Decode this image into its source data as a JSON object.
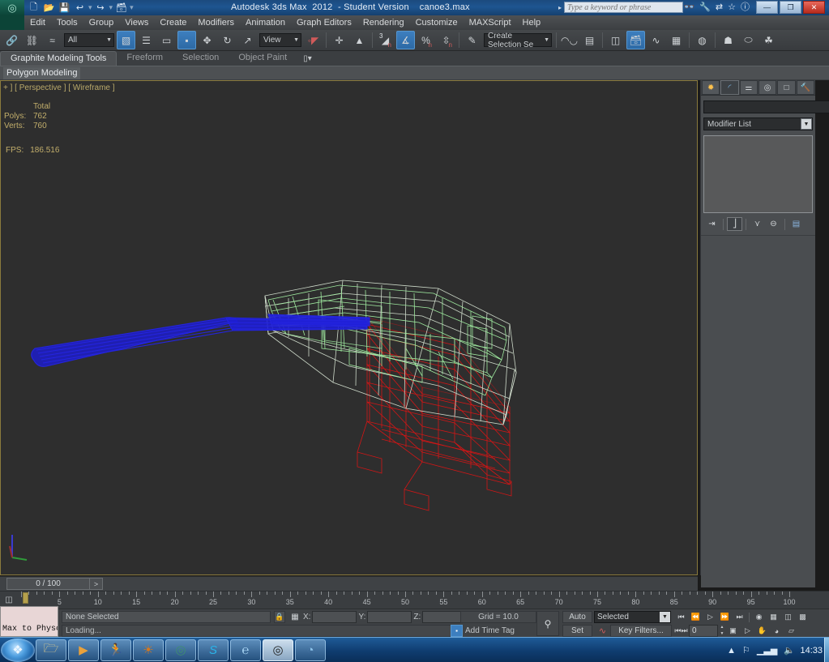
{
  "titlebar": {
    "title": "Autodesk 3ds Max  2012  - Student Version    canoe3.max",
    "search_placeholder": "Type a keyword or phrase",
    "help_icons": [
      "binoculars-icon",
      "wrench-icon",
      "exchange-icon",
      "star-icon",
      "help-icon"
    ],
    "window_buttons": {
      "minimize": "—",
      "maximize": "❐",
      "close": "✕"
    },
    "quick_access": [
      "new-file-icon",
      "open-file-icon",
      "save-file-icon",
      "undo-icon",
      "redo-icon",
      "project-folder-icon",
      "customize-qat-icon"
    ]
  },
  "menubar": {
    "items": [
      {
        "label": "Edit"
      },
      {
        "label": "Tools"
      },
      {
        "label": "Group"
      },
      {
        "label": "Views"
      },
      {
        "label": "Create"
      },
      {
        "label": "Modifiers"
      },
      {
        "label": "Animation"
      },
      {
        "label": "Graph Editors"
      },
      {
        "label": "Rendering"
      },
      {
        "label": "Customize"
      },
      {
        "label": "MAXScript"
      },
      {
        "label": "Help"
      }
    ]
  },
  "main_toolbar": {
    "selection_filter": "All",
    "reference_coord_system": "View",
    "named_selection_set": "Create Selection Se",
    "buttons": [
      {
        "name": "select-and-link-icon",
        "glyph": "🔗"
      },
      {
        "name": "unlink-selection-icon",
        "glyph": "⛓"
      },
      {
        "name": "bind-to-space-warp-icon",
        "glyph": "≈"
      },
      {
        "name": "select-object-icon",
        "glyph": "▣",
        "active": true
      },
      {
        "name": "select-by-name-icon",
        "glyph": "☰"
      },
      {
        "name": "rectangular-selection-region-icon",
        "glyph": "▭"
      },
      {
        "name": "window-crossing-toggle-icon",
        "glyph": "◪",
        "active": true
      },
      {
        "name": "select-and-move-icon",
        "glyph": "✥"
      },
      {
        "name": "select-and-rotate-icon",
        "glyph": "↻"
      },
      {
        "name": "select-and-scale-icon",
        "glyph": "⬈"
      },
      {
        "name": "use-pivot-point-center-icon",
        "glyph": "▮"
      },
      {
        "name": "select-and-manipulate-icon",
        "glyph": "✛"
      },
      {
        "name": "snaps-toggle-icon",
        "glyph": "⬘",
        "sup": "3"
      },
      {
        "name": "angle-snap-toggle-icon",
        "glyph": "∡",
        "active": true
      },
      {
        "name": "percent-snap-toggle-icon",
        "glyph": "%"
      },
      {
        "name": "spinner-snap-toggle-icon",
        "glyph": "⇳"
      },
      {
        "name": "edit-named-selection-sets-icon",
        "glyph": "✎"
      },
      {
        "name": "mirror-icon",
        "glyph": "◨"
      },
      {
        "name": "align-icon",
        "glyph": "▤"
      },
      {
        "name": "layer-manager-icon",
        "glyph": "▧"
      },
      {
        "name": "manage-scene-states-icon",
        "glyph": "🗔",
        "active": true
      },
      {
        "name": "curve-editor-icon",
        "glyph": "📈"
      },
      {
        "name": "schematic-view-icon",
        "glyph": "▦"
      },
      {
        "name": "material-editor-icon",
        "glyph": "◍"
      },
      {
        "name": "render-setup-icon",
        "glyph": "🫖"
      },
      {
        "name": "rendered-frame-window-icon",
        "glyph": "⬭"
      },
      {
        "name": "render-production-icon",
        "glyph": "🫖"
      }
    ]
  },
  "ribbon": {
    "tabs": [
      {
        "label": "Graphite Modeling Tools",
        "active": true
      },
      {
        "label": "Freeform",
        "active": false
      },
      {
        "label": "Selection",
        "active": false
      },
      {
        "label": "Object Paint",
        "active": false
      }
    ],
    "overflow_icon": "panel-dropdown-icon",
    "subtab_label": "Polygon Modeling"
  },
  "viewport": {
    "label": "+ ] [ Perspective ] [ Wireframe ]",
    "stats": {
      "header": "Total",
      "rows": [
        {
          "label": "Polys:",
          "value": "762"
        },
        {
          "label": "Verts:",
          "value": "760"
        }
      ],
      "fps_label": "FPS:",
      "fps_value": "186.516"
    },
    "background_color": "#2e2e2e",
    "border_color": "#8a7a3d",
    "objects": [
      {
        "name": "canoe-hull-wireframe",
        "color": "#b7e8b7"
      },
      {
        "name": "canoe-hull-outer-wireframe",
        "color": "#ccd8c8"
      },
      {
        "name": "paddle-wireframe",
        "color": "#2020d8"
      },
      {
        "name": "stand-wireframe",
        "color": "#d81818"
      }
    ]
  },
  "command_panel": {
    "tabs": [
      {
        "name": "create-tab",
        "glyph": "✹",
        "selected": false
      },
      {
        "name": "modify-tab",
        "glyph": "◝",
        "selected": true
      },
      {
        "name": "hierarchy-tab",
        "glyph": "⛬",
        "selected": false
      },
      {
        "name": "motion-tab",
        "glyph": "◎",
        "selected": false
      },
      {
        "name": "display-tab",
        "glyph": "❑",
        "selected": false
      },
      {
        "name": "utilities-tab",
        "glyph": "🔨",
        "selected": false
      }
    ],
    "object_name": "",
    "object_color": "#99223c",
    "modifier_list_label": "Modifier List",
    "stack_items": [],
    "stack_buttons": [
      {
        "name": "pin-stack-button",
        "glyph": "⇥"
      },
      {
        "name": "show-end-result-button",
        "glyph": "⌶",
        "active": true
      },
      {
        "name": "make-unique-button",
        "glyph": "⋎"
      },
      {
        "name": "remove-modifier-button",
        "glyph": "⊖"
      },
      {
        "name": "configure-modifier-sets-button",
        "glyph": "▤"
      }
    ]
  },
  "time_slider": {
    "frame_readout": "0 / 100",
    "next_button": ">"
  },
  "track_bar": {
    "open_mini_curve_editor_icon": "mini-curve-editor-icon",
    "tick_labels": [
      "5",
      "10",
      "15",
      "20",
      "25",
      "30",
      "35",
      "40",
      "45",
      "50",
      "55",
      "60",
      "65",
      "70",
      "75",
      "80",
      "85",
      "90",
      "95",
      "100"
    ],
    "range_start": 0,
    "range_end": 100,
    "playhead_frame": 0
  },
  "status_bar": {
    "prompt_line": "None Selected",
    "status_line": "Loading...",
    "lock_selection_icon": "lock-icon",
    "transform_type_in": {
      "icon": "absolute-mode-transform-icon",
      "x_label": "X:",
      "x_value": "",
      "y_label": "Y:",
      "y_value": "",
      "z_label": "Z:",
      "z_value": ""
    },
    "grid_label": "Grid = 10.0",
    "time_tag": {
      "icon": "time-tag-icon",
      "label": "Add Time Tag"
    },
    "key_mode_icon": "set-key-mode-icon",
    "auto_key_label": "Auto Key",
    "set_key_label": "Set Key",
    "selection_scope": "Selected",
    "key_filters_label": "Key Filters...",
    "current_frame": "0",
    "playback_buttons_row1": [
      {
        "name": "go-to-start-button",
        "glyph": "|◁◁"
      },
      {
        "name": "previous-frame-button",
        "glyph": "◁|▮"
      },
      {
        "name": "play-animation-button",
        "glyph": "▷"
      },
      {
        "name": "next-frame-button",
        "glyph": "▮|▷"
      },
      {
        "name": "go-to-end-button",
        "glyph": "▷▷|"
      },
      {
        "name": "key-mode-toggle-button",
        "glyph": "◉"
      },
      {
        "name": "select-keyboard-shortcut-button",
        "glyph": "▦"
      },
      {
        "name": "zoom-extents-all-button",
        "glyph": "⬚"
      },
      {
        "name": "zoom-extents-all-selected-button",
        "glyph": "▩"
      }
    ],
    "playback_buttons_row2": [
      {
        "name": "key-mode-button",
        "glyph": "|◀▶|"
      },
      {
        "name": "time-configuration-button",
        "glyph": "▣"
      },
      {
        "name": "field-of-view-button",
        "glyph": "▷"
      },
      {
        "name": "pan-view-button",
        "glyph": "✋"
      },
      {
        "name": "orbit-view-button",
        "glyph": "◕"
      },
      {
        "name": "maximize-viewport-toggle-button",
        "glyph": "◱"
      }
    ]
  },
  "ghost_window": {
    "text": "Max to Physc:"
  },
  "taskbar": {
    "start_label": "start-orb",
    "items": [
      {
        "name": "taskbar-windows-explorer",
        "glyph": "🗂",
        "color": "#f0d78a",
        "state": "pinned"
      },
      {
        "name": "taskbar-media-player",
        "glyph": "▶",
        "color": "#e9a13b",
        "state": "pinned"
      },
      {
        "name": "taskbar-gimp",
        "glyph": "🏃",
        "color": "#6b4a28",
        "state": "pinned"
      },
      {
        "name": "taskbar-browser-globe",
        "glyph": "🌐",
        "color": "#d4781f",
        "state": "pinned"
      },
      {
        "name": "taskbar-3ds-max-window",
        "glyph": "🐍",
        "color": "#3f8f6f",
        "state": "open"
      },
      {
        "name": "taskbar-skype",
        "glyph": "S",
        "color": "#2bb3e8",
        "state": "open"
      },
      {
        "name": "taskbar-internet-explorer",
        "glyph": "℮",
        "color": "#4fa8e8",
        "state": "open"
      },
      {
        "name": "taskbar-photo-viewer",
        "glyph": "◎",
        "color": "#1f1f1f",
        "state": "active"
      },
      {
        "name": "taskbar-antivirus",
        "glyph": "◔",
        "color": "#5b8fc9",
        "state": "open"
      }
    ],
    "tray": [
      {
        "name": "show-hidden-icons-icon",
        "glyph": "▲"
      },
      {
        "name": "network-flag-icon",
        "glyph": "⚐"
      },
      {
        "name": "network-signal-icon",
        "glyph": "▂▄▆"
      },
      {
        "name": "volume-icon",
        "glyph": "🔊"
      }
    ],
    "clock": "14:33"
  }
}
